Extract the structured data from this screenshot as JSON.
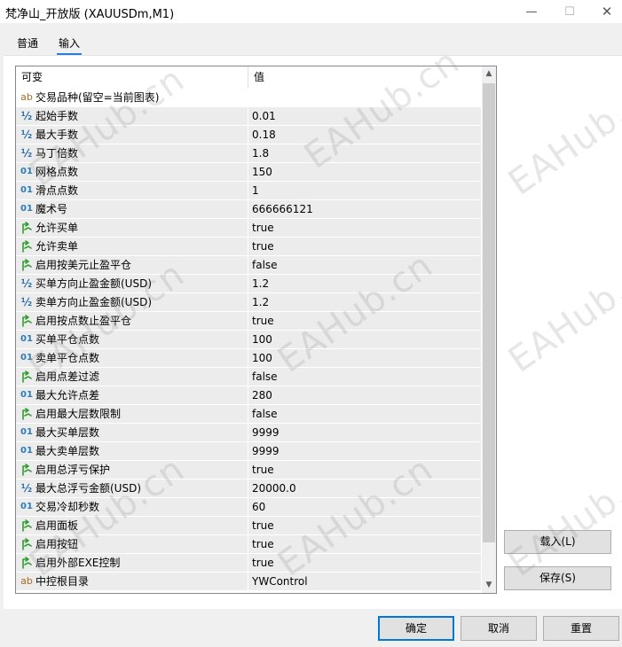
{
  "window": {
    "title": "梵净山_开放版 (XAUUSDm,M1)",
    "minimize_glyph": "—",
    "maximize_glyph": "☐",
    "close_glyph": "✕"
  },
  "tabs": [
    {
      "label": "普通",
      "selected": false
    },
    {
      "label": "输入",
      "selected": true
    }
  ],
  "grid": {
    "col_name": "可变",
    "col_value": "值",
    "rows": [
      {
        "type": "string",
        "icon": "ab",
        "name": "交易品种(留空=当前图表)",
        "value": ""
      },
      {
        "type": "double",
        "icon": "½",
        "name": "起始手数",
        "value": "0.01"
      },
      {
        "type": "double",
        "icon": "½",
        "name": "最大手数",
        "value": "0.18"
      },
      {
        "type": "double",
        "icon": "½",
        "name": "马丁倍数",
        "value": "1.8"
      },
      {
        "type": "int",
        "icon": "01",
        "name": "网格点数",
        "value": "150"
      },
      {
        "type": "int",
        "icon": "01",
        "name": "滑点点数",
        "value": "1"
      },
      {
        "type": "int",
        "icon": "01",
        "name": "魔术号",
        "value": "666666121"
      },
      {
        "type": "bool",
        "icon": "bool",
        "name": "允许买单",
        "value": "true"
      },
      {
        "type": "bool",
        "icon": "bool",
        "name": "允许卖单",
        "value": "true"
      },
      {
        "type": "bool",
        "icon": "bool",
        "name": "启用按美元止盈平仓",
        "value": "false"
      },
      {
        "type": "double",
        "icon": "½",
        "name": "买单方向止盈金额(USD)",
        "value": "1.2"
      },
      {
        "type": "double",
        "icon": "½",
        "name": "卖单方向止盈金额(USD)",
        "value": "1.2"
      },
      {
        "type": "bool",
        "icon": "bool",
        "name": "启用按点数止盈平仓",
        "value": "true"
      },
      {
        "type": "int",
        "icon": "01",
        "name": "买单平仓点数",
        "value": "100"
      },
      {
        "type": "int",
        "icon": "01",
        "name": "卖单平仓点数",
        "value": "100"
      },
      {
        "type": "bool",
        "icon": "bool",
        "name": "启用点差过滤",
        "value": "false"
      },
      {
        "type": "int",
        "icon": "01",
        "name": "最大允许点差",
        "value": "280"
      },
      {
        "type": "bool",
        "icon": "bool",
        "name": "启用最大层数限制",
        "value": "false"
      },
      {
        "type": "int",
        "icon": "01",
        "name": "最大买单层数",
        "value": "9999"
      },
      {
        "type": "int",
        "icon": "01",
        "name": "最大卖单层数",
        "value": "9999"
      },
      {
        "type": "bool",
        "icon": "bool",
        "name": "启用总浮亏保护",
        "value": "true"
      },
      {
        "type": "double",
        "icon": "½",
        "name": "最大总浮亏金额(USD)",
        "value": "20000.0"
      },
      {
        "type": "int",
        "icon": "01",
        "name": "交易冷却秒数",
        "value": "60"
      },
      {
        "type": "bool",
        "icon": "bool",
        "name": "启用面板",
        "value": "true"
      },
      {
        "type": "bool",
        "icon": "bool",
        "name": "启用按钮",
        "value": "true"
      },
      {
        "type": "bool",
        "icon": "bool",
        "name": "启用外部EXE控制",
        "value": "true"
      },
      {
        "type": "string",
        "icon": "ab",
        "name": "中控根目录",
        "value": "YWControl"
      }
    ]
  },
  "side_buttons": {
    "load": "载入(L)",
    "save": "保存(S)"
  },
  "bottom_buttons": {
    "ok": "确定",
    "cancel": "取消",
    "reset": "重置"
  },
  "watermark": "EAHub.cn",
  "colors": {
    "accent": "#0078d7",
    "tab_underline": "#2a7fd4",
    "bool_icon": "#2f9e2f",
    "int_icon": "#2e7bb5",
    "string_icon": "#a86d1e"
  }
}
